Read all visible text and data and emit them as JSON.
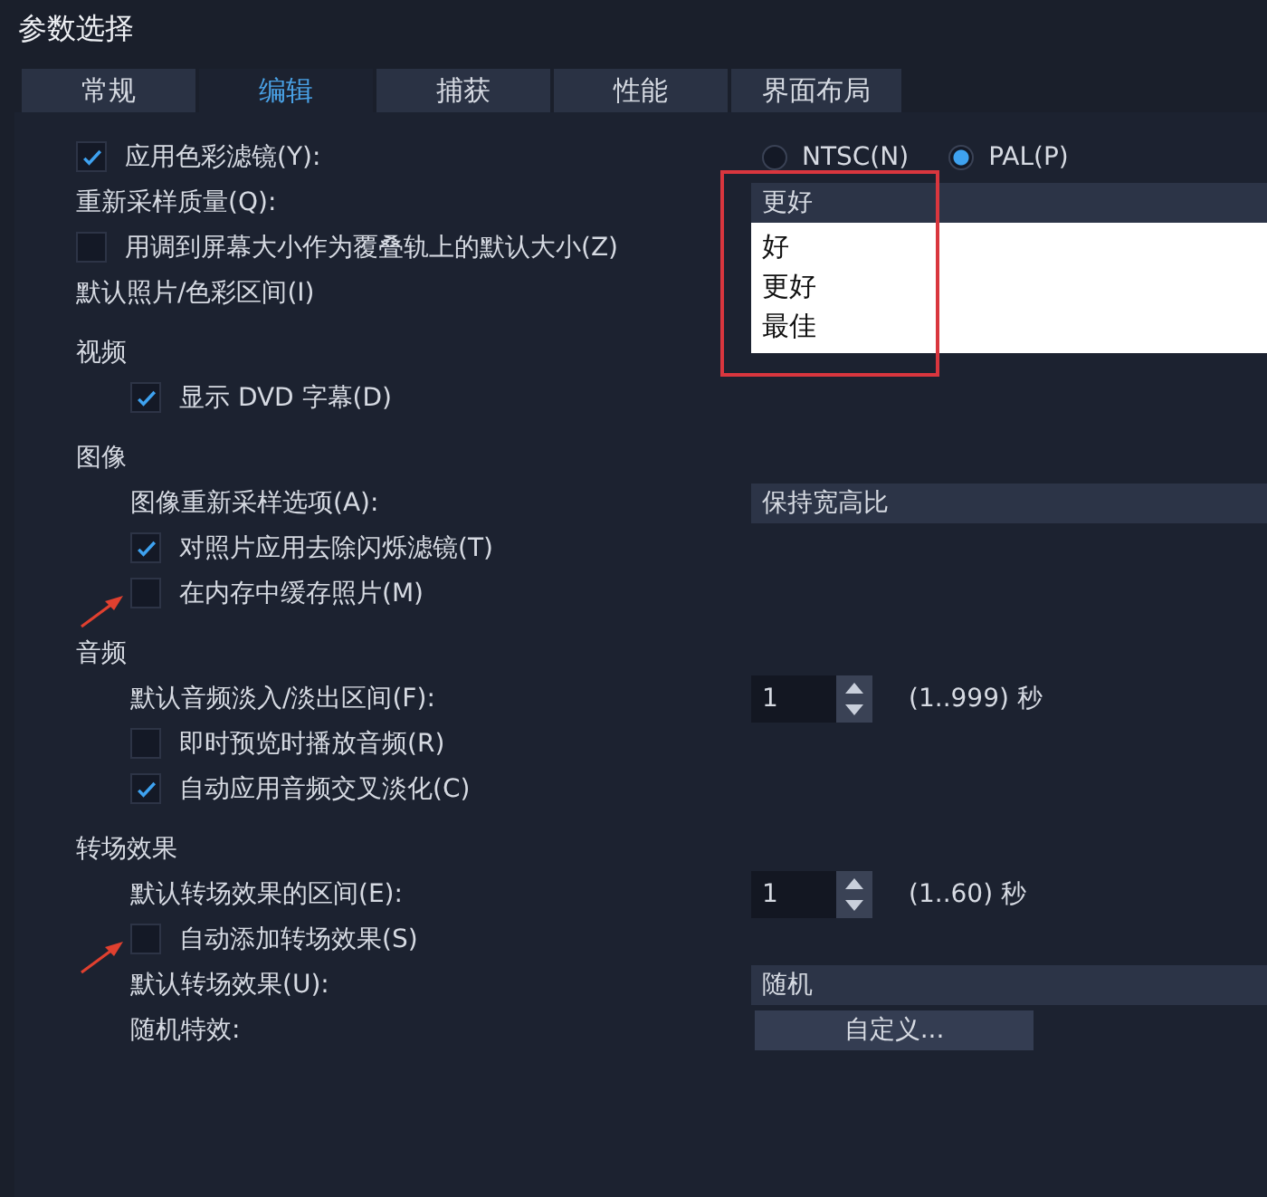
{
  "window": {
    "title": "参数选择"
  },
  "tabs": [
    {
      "label": "常规",
      "selected": false
    },
    {
      "label": "编辑",
      "selected": true
    },
    {
      "label": "捕获",
      "selected": false
    },
    {
      "label": "性能",
      "selected": false
    },
    {
      "label": "界面布局",
      "selected": false
    }
  ],
  "items": [
    {
      "kind": "check",
      "label": "应用色彩滤镜(Y):",
      "checked": true,
      "pointer": false,
      "right": {
        "kind": "radios",
        "options": [
          {
            "label": "NTSC(N)",
            "selected": false
          },
          {
            "label": "PAL(P)",
            "selected": true
          }
        ]
      }
    },
    {
      "kind": "label",
      "label": "重新采样质量(Q):",
      "right": {
        "kind": "dropdown",
        "value": "更好",
        "open": true,
        "highlighted": true,
        "options": [
          "好",
          "更好",
          "最佳"
        ]
      }
    },
    {
      "kind": "check",
      "label": "用调到屏幕大小作为覆叠轨上的默认大小(Z)",
      "checked": false,
      "pointer": false
    },
    {
      "kind": "label",
      "label": "默认照片/色彩区间(I)"
    },
    {
      "kind": "section",
      "title": "视频",
      "children": [
        {
          "kind": "check",
          "label": "显示 DVD 字幕(D)",
          "checked": true,
          "pointer": false
        }
      ]
    },
    {
      "kind": "section",
      "title": "图像",
      "children": [
        {
          "kind": "label",
          "label": "图像重新采样选项(A):",
          "right": {
            "kind": "select",
            "value": "保持宽高比"
          }
        },
        {
          "kind": "check",
          "label": "对照片应用去除闪烁滤镜(T)",
          "checked": true,
          "pointer": false
        },
        {
          "kind": "check",
          "label": "在内存中缓存照片(M)",
          "checked": false,
          "pointer": true
        }
      ]
    },
    {
      "kind": "section",
      "title": "音频",
      "children": [
        {
          "kind": "label",
          "label": "默认音频淡入/淡出区间(F):",
          "right": {
            "kind": "spin",
            "value": "1",
            "range": "(1..999) 秒"
          }
        },
        {
          "kind": "check",
          "label": "即时预览时播放音频(R)",
          "checked": false,
          "pointer": false
        },
        {
          "kind": "check",
          "label": "自动应用音频交叉淡化(C)",
          "checked": true,
          "pointer": false
        }
      ]
    },
    {
      "kind": "section",
      "title": "转场效果",
      "children": [
        {
          "kind": "label",
          "label": "默认转场效果的区间(E):",
          "right": {
            "kind": "spin",
            "value": "1",
            "range": "(1..60) 秒"
          }
        },
        {
          "kind": "check",
          "label": "自动添加转场效果(S)",
          "checked": false,
          "pointer": true
        },
        {
          "kind": "label",
          "label": "默认转场效果(U):",
          "right": {
            "kind": "select",
            "value": "随机"
          }
        },
        {
          "kind": "label",
          "label": "随机特效:",
          "right": {
            "kind": "button",
            "label": "自定义..."
          }
        }
      ]
    }
  ]
}
